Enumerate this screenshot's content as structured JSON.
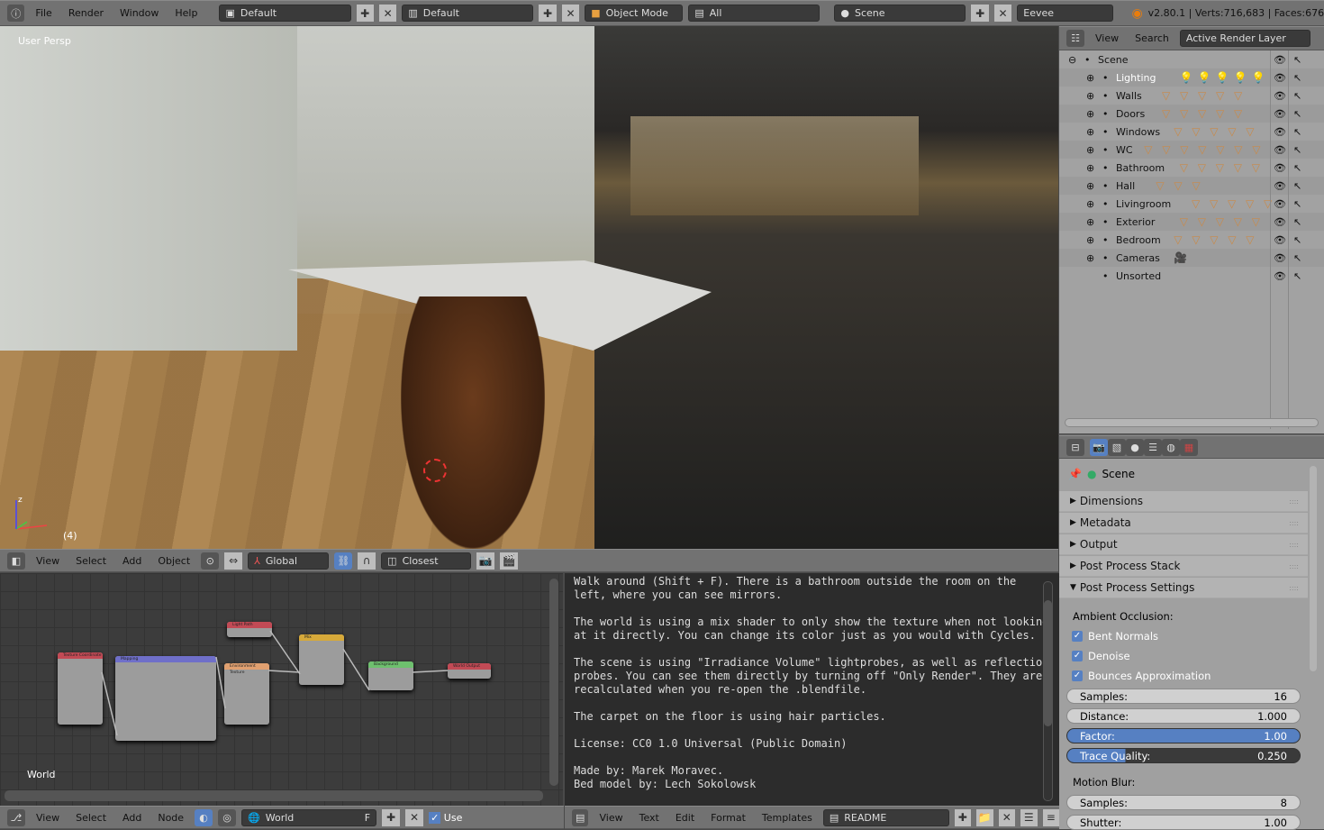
{
  "topbar": {
    "menus": [
      "File",
      "Render",
      "Window",
      "Help"
    ],
    "screen_layout": "Default",
    "screen": "Default",
    "mode": "Object Mode",
    "layers": "All",
    "scene": "Scene",
    "engine": "Eevee",
    "stats": "v2.80.1 | Verts:716,683 | Faces:676"
  },
  "viewport": {
    "label": "User Persp",
    "frame": "(4)"
  },
  "view3d_header": {
    "menus": [
      "View",
      "Select",
      "Add",
      "Object"
    ],
    "orientation": "Global",
    "snap": "Closest"
  },
  "outliner": {
    "menus": [
      "View",
      "Search"
    ],
    "display": "Active Render Layer",
    "items": [
      {
        "label": "Scene",
        "level": 0,
        "icons": 0,
        "icon": ""
      },
      {
        "label": "Lighting",
        "level": 1,
        "icons": 5,
        "icon": "lamp"
      },
      {
        "label": "Walls",
        "level": 1,
        "icons": 5,
        "icon": "mesh"
      },
      {
        "label": "Doors",
        "level": 1,
        "icons": 5,
        "icon": "mesh"
      },
      {
        "label": "Windows",
        "level": 1,
        "icons": 5,
        "icon": "mesh"
      },
      {
        "label": "WC",
        "level": 1,
        "icons": 7,
        "icon": "mesh"
      },
      {
        "label": "Bathroom",
        "level": 1,
        "icons": 5,
        "icon": "mesh"
      },
      {
        "label": "Hall",
        "level": 1,
        "icons": 3,
        "icon": "mesh"
      },
      {
        "label": "Livingroom",
        "level": 1,
        "icons": 5,
        "icon": "mesh"
      },
      {
        "label": "Exterior",
        "level": 1,
        "icons": 6,
        "icon": "mesh"
      },
      {
        "label": "Bedroom",
        "level": 1,
        "icons": 5,
        "icon": "mesh"
      },
      {
        "label": "Cameras",
        "level": 1,
        "icons": 1,
        "icon": "camera"
      },
      {
        "label": "Unsorted",
        "level": 1,
        "icons": 0,
        "icon": ""
      }
    ]
  },
  "properties": {
    "context": "Scene",
    "panels": [
      {
        "label": "Dimensions",
        "open": false
      },
      {
        "label": "Metadata",
        "open": false
      },
      {
        "label": "Output",
        "open": false
      },
      {
        "label": "Post Process Stack",
        "open": false
      },
      {
        "label": "Post Process Settings",
        "open": true
      }
    ],
    "ao_heading": "Ambient Occlusion:",
    "checks": [
      {
        "label": "Bent Normals",
        "checked": true
      },
      {
        "label": "Denoise",
        "checked": true
      },
      {
        "label": "Bounces Approximation",
        "checked": true
      }
    ],
    "fields": [
      {
        "label": "Samples:",
        "value": "16",
        "style": "num"
      },
      {
        "label": "Distance:",
        "value": "1.000",
        "style": "num"
      },
      {
        "label": "Factor:",
        "value": "1.00",
        "style": "slider",
        "fill": 1.0
      },
      {
        "label": "Trace Quality:",
        "value": "0.250",
        "style": "slider",
        "fill": 0.25
      }
    ],
    "mb_heading": "Motion Blur:",
    "mb_fields": [
      {
        "label": "Samples:",
        "value": "8"
      },
      {
        "label": "Shutter:",
        "value": "1.00"
      }
    ]
  },
  "nodes": {
    "label": "World",
    "items": [
      {
        "title": "Texture Coordinate",
        "color": "#c24a55"
      },
      {
        "title": "Mapping",
        "color": "#6f6fc9"
      },
      {
        "title": "Environment Texture",
        "color": "#e0a070"
      },
      {
        "title": "Light Path",
        "color": "#c24a55"
      },
      {
        "title": "Mix",
        "color": "#d6a93a"
      },
      {
        "title": "Background",
        "color": "#6ec06e"
      },
      {
        "title": "World Output",
        "color": "#c24a55"
      }
    ]
  },
  "node_header": {
    "menus": [
      "View",
      "Select",
      "Add",
      "Node"
    ],
    "world": "World",
    "fake_user": "F",
    "use_nodes": "Use Nodes"
  },
  "text_editor": {
    "content": "Walk around (Shift + F). There is a bathroom outside the room on the\nleft, where you can see mirrors.\n\nThe world is using a mix shader to only show the texture when not looking\nat it directly. You can change its color just as you would with Cycles.\n\nThe scene is using \"Irradiance Volume\" lightprobes, as well as reflection\nprobes. You can see them directly by turning off \"Only Render\". They are\nrecalculated when you re-open the .blendfile.\n\nThe carpet on the floor is using hair particles.\n\nLicense: CC0 1.0 Universal (Public Domain)\n\nMade by: Marek Moravec.\nBed model by: Lech Sokolowsk"
  },
  "text_header": {
    "menus": [
      "View",
      "Text",
      "Edit",
      "Format",
      "Templates"
    ],
    "file": "README"
  },
  "colors": {
    "accent": "#5680c2",
    "header": "#727272",
    "text_bg": "#2c2c2c"
  }
}
